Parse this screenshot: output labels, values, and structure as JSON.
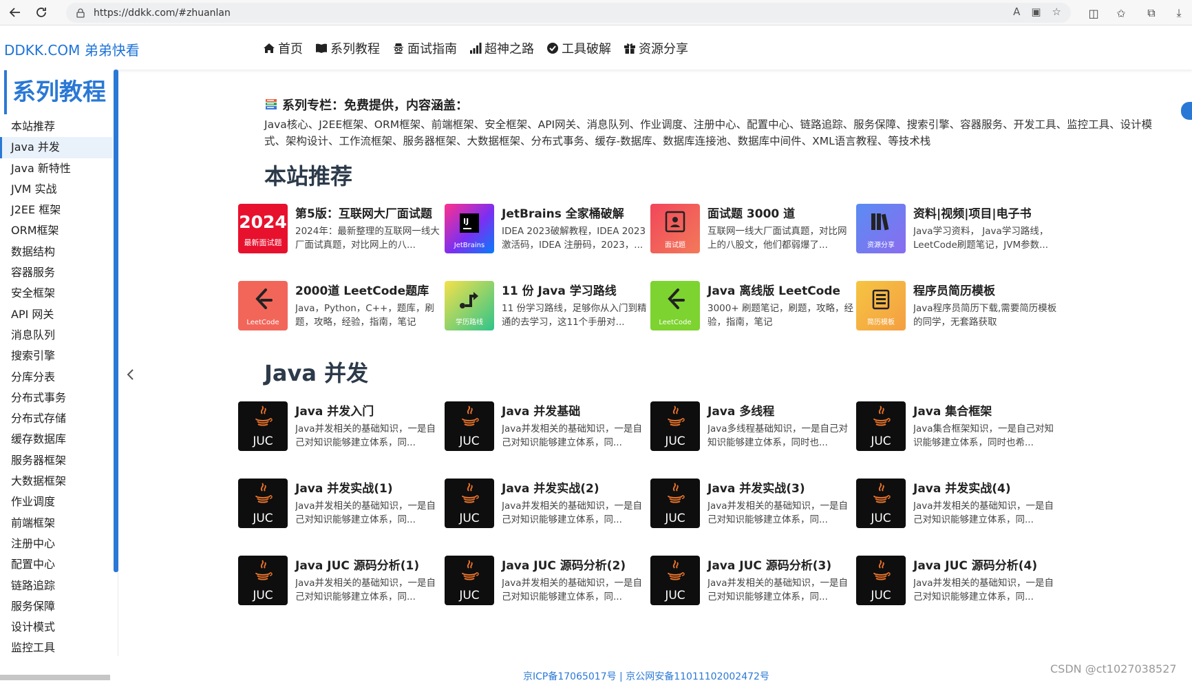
{
  "browser": {
    "url": "https://ddkk.com/#zhuanlan"
  },
  "header": {
    "logo": "DDKK.COM 弟弟快看",
    "nav": [
      {
        "label": "首页",
        "icon": "home-icon"
      },
      {
        "label": "系列教程",
        "icon": "book-open-icon"
      },
      {
        "label": "面试指南",
        "icon": "user-secret-icon"
      },
      {
        "label": "超神之路",
        "icon": "signal-icon"
      },
      {
        "label": "工具破解",
        "icon": "check-circle-icon"
      },
      {
        "label": "资源分享",
        "icon": "gift-icon"
      }
    ]
  },
  "sidebar": {
    "title": "系列教程",
    "items": [
      {
        "label": "本站推荐",
        "active": false
      },
      {
        "label": "Java 并发",
        "active": true
      },
      {
        "label": "Java 新特性",
        "active": false
      },
      {
        "label": "JVM 实战",
        "active": false
      },
      {
        "label": "J2EE 框架",
        "active": false
      },
      {
        "label": "ORM框架",
        "active": false
      },
      {
        "label": "数据结构",
        "active": false
      },
      {
        "label": "容器服务",
        "active": false
      },
      {
        "label": "安全框架",
        "active": false
      },
      {
        "label": "API 网关",
        "active": false
      },
      {
        "label": "消息队列",
        "active": false
      },
      {
        "label": "搜索引擎",
        "active": false
      },
      {
        "label": "分库分表",
        "active": false
      },
      {
        "label": "分布式事务",
        "active": false
      },
      {
        "label": "分布式存储",
        "active": false
      },
      {
        "label": "缓存数据库",
        "active": false
      },
      {
        "label": "服务器框架",
        "active": false
      },
      {
        "label": "大数据框架",
        "active": false
      },
      {
        "label": "作业调度",
        "active": false
      },
      {
        "label": "前端框架",
        "active": false
      },
      {
        "label": "注册中心",
        "active": false
      },
      {
        "label": "配置中心",
        "active": false
      },
      {
        "label": "链路追踪",
        "active": false
      },
      {
        "label": "服务保障",
        "active": false
      },
      {
        "label": "设计模式",
        "active": false
      },
      {
        "label": "监控工具",
        "active": false
      }
    ]
  },
  "intro": {
    "title": "系列专栏：免费提供，内容涵盖：",
    "text": "Java核心、J2EE框架、ORM框架、前端框架、安全框架、API网关、消息队列、作业调度、注册中心、配置中心、链路追踪、服务保障、搜索引擎、容器服务、开发工具、监控工具、设计模式、架构设计、工作流框架、服务器框架、大数据框架、分布式事务、缓存-数据库、数据库连接池、数据库中间件、XML语言教程、等技术栈"
  },
  "sections": [
    {
      "title": "本站推荐",
      "cards": [
        {
          "title": "第5版：互联网大厂面试题",
          "desc": "2024年：最新整理的互联网一线大厂面试真题，对比网上的八...",
          "thumb": {
            "type": "year",
            "big": "2024",
            "small": "最新面试题",
            "bg": "#e8112d"
          }
        },
        {
          "title": "JetBrains 全家桶破解",
          "desc": "IDEA 2023破解教程，IDEA 2023 激活码，IDEA 注册码，2023，...",
          "thumb": {
            "type": "jetbrains",
            "small": "JetBrains",
            "bg": "#7b2ff2"
          }
        },
        {
          "title": "面试题 3000 道",
          "desc": "互联网一线大厂面试真题，对比网上的八股文，他们都弱爆了...",
          "thumb": {
            "type": "interview",
            "small": "面试题",
            "bg": "#f2465a"
          }
        },
        {
          "title": "资料|视频|项目|电子书",
          "desc": "Java学习资料， Java学习路线，LeetCode刷题笔记，JVM参数...",
          "thumb": {
            "type": "books",
            "small": "资源分享",
            "bg": "#6a7cf0"
          }
        },
        {
          "title": "2000道 LeetCode题库",
          "desc": "Java，Python，C++，题库，刷题，攻略，经验，指南，笔记",
          "thumb": {
            "type": "leetcode",
            "small": "LeetCode",
            "bg": "#f2665a"
          }
        },
        {
          "title": "11 份 Java 学习路线",
          "desc": "11 份学习路线，足够你从入门到精通的去学习，这11个手册对...",
          "thumb": {
            "type": "route",
            "small": "学历路线",
            "bg": "#2fc48a"
          }
        },
        {
          "title": "Java 离线版 LeetCode",
          "desc": "3000+ 刷题笔记，刷题，攻略，经验，指南，笔记",
          "thumb": {
            "type": "leetcode",
            "small": "LeetCode",
            "bg": "#7dd32f"
          }
        },
        {
          "title": "程序员简历模板",
          "desc": "Java程序员简历下载,需要简历模板的同学，无套路获取",
          "thumb": {
            "type": "resume",
            "small": "简历模板",
            "bg": "#f5a742"
          }
        }
      ]
    },
    {
      "title": "Java 并发",
      "cards": [
        {
          "title": "Java 并发入门",
          "desc": "Java并发相关的基础知识，一是自己对知识能够建立体系，同...",
          "thumb": {
            "type": "juc",
            "small": "JUC",
            "bg": "#0e0e0e"
          }
        },
        {
          "title": "Java 并发基础",
          "desc": "Java并发相关的基础知识，一是自己对知识能够建立体系，同...",
          "thumb": {
            "type": "juc",
            "small": "JUC",
            "bg": "#0e0e0e"
          }
        },
        {
          "title": "Java 多线程",
          "desc": "Java多线程基础知识，一是自己对知识能够建立体系，同时也...",
          "thumb": {
            "type": "juc",
            "small": "JUC",
            "bg": "#0e0e0e"
          }
        },
        {
          "title": "Java 集合框架",
          "desc": "Java集合框架知识，一是自己对知识能够建立体系，同时也希...",
          "thumb": {
            "type": "juc",
            "small": "JUC",
            "bg": "#0e0e0e"
          }
        },
        {
          "title": "Java 并发实战(1)",
          "desc": "Java并发相关的基础知识，一是自己对知识能够建立体系，同...",
          "thumb": {
            "type": "juc",
            "small": "JUC",
            "bg": "#0e0e0e"
          }
        },
        {
          "title": "Java 并发实战(2)",
          "desc": "Java并发相关的基础知识，一是自己对知识能够建立体系，同...",
          "thumb": {
            "type": "juc",
            "small": "JUC",
            "bg": "#0e0e0e"
          }
        },
        {
          "title": "Java 并发实战(3)",
          "desc": "Java并发相关的基础知识，一是自己对知识能够建立体系，同...",
          "thumb": {
            "type": "juc",
            "small": "JUC",
            "bg": "#0e0e0e"
          }
        },
        {
          "title": "Java 并发实战(4)",
          "desc": "Java并发相关的基础知识，一是自己对知识能够建立体系，同...",
          "thumb": {
            "type": "juc",
            "small": "JUC",
            "bg": "#0e0e0e"
          }
        },
        {
          "title": "Java JUC 源码分析(1)",
          "desc": "Java并发相关的基础知识，一是自己对知识能够建立体系，同...",
          "thumb": {
            "type": "juc",
            "small": "JUC",
            "bg": "#0e0e0e"
          }
        },
        {
          "title": "Java JUC 源码分析(2)",
          "desc": "Java并发相关的基础知识，一是自己对知识能够建立体系，同...",
          "thumb": {
            "type": "juc",
            "small": "JUC",
            "bg": "#0e0e0e"
          }
        },
        {
          "title": "Java JUC 源码分析(3)",
          "desc": "Java并发相关的基础知识，一是自己对知识能够建立体系，同...",
          "thumb": {
            "type": "juc",
            "small": "JUC",
            "bg": "#0e0e0e"
          }
        },
        {
          "title": "Java JUC 源码分析(4)",
          "desc": "Java并发相关的基础知识，一是自己对知识能够建立体系，同...",
          "thumb": {
            "type": "juc",
            "small": "JUC",
            "bg": "#0e0e0e"
          }
        }
      ]
    }
  ],
  "footer": {
    "icp": "京ICP备17065017号 | 京公网安备11011102002472号",
    "watermark": "CSDN @ct1027038527"
  },
  "colors": {
    "accent": "#2a78d6",
    "active_bg": "#e9f1fb"
  }
}
